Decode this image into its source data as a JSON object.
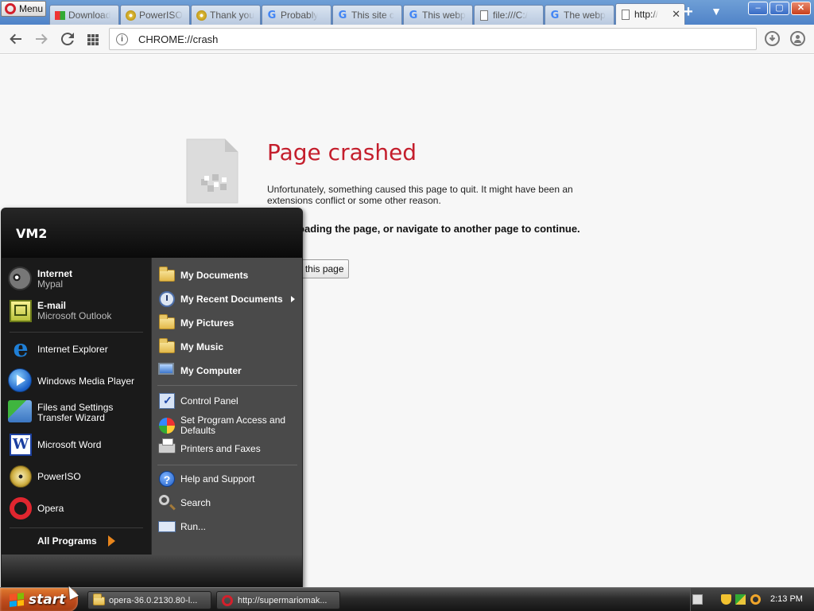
{
  "browser": {
    "menu_label": "Menu",
    "tabs": [
      {
        "title": "Download",
        "icon": "app-icon"
      },
      {
        "title": "PowerISO",
        "icon": "poweriso-icon"
      },
      {
        "title": "Thank you",
        "icon": "poweriso-icon"
      },
      {
        "title": "Probably",
        "icon": "google-icon"
      },
      {
        "title": "This site c",
        "icon": "google-icon"
      },
      {
        "title": "This webp",
        "icon": "google-icon"
      },
      {
        "title": "file:///C:/",
        "icon": "file-icon"
      },
      {
        "title": "The webp",
        "icon": "google-icon"
      },
      {
        "title": "http://",
        "icon": "file-icon",
        "active": true
      }
    ],
    "new_tab_symbol": "+",
    "window_buttons": {
      "minimize": "–",
      "maximize": "▢",
      "close": "✕"
    },
    "url": "CHROME://crash",
    "url_info_symbol": "i"
  },
  "page": {
    "title": "Page crashed",
    "message": "Unfortunately, something caused this page to quit. It might have been an extensions conflict or some other reason.",
    "help": "Try reloading the page, or navigate to another page to continue.",
    "reload_label": "Reload this page"
  },
  "start_menu": {
    "user_name": "VM2",
    "pinned": [
      {
        "title": "Internet",
        "subtitle": "Mypal"
      },
      {
        "title": "E-mail",
        "subtitle": "Microsoft Outlook"
      }
    ],
    "recent": [
      {
        "title": "Internet Explorer"
      },
      {
        "title": "Windows Media Player"
      },
      {
        "title": "Files and Settings Transfer Wizard"
      },
      {
        "title": "Microsoft Word"
      },
      {
        "title": "PowerISO"
      },
      {
        "title": "Opera"
      }
    ],
    "all_programs": "All Programs",
    "places": [
      {
        "title": "My Documents"
      },
      {
        "title": "My Recent Documents"
      },
      {
        "title": "My Pictures"
      },
      {
        "title": "My Music"
      },
      {
        "title": "My Computer"
      }
    ],
    "system": [
      {
        "title": "Control Panel"
      },
      {
        "title": "Set Program Access and Defaults"
      },
      {
        "title": "Printers and Faxes"
      }
    ],
    "support": [
      {
        "title": "Help and Support"
      },
      {
        "title": "Search"
      },
      {
        "title": "Run..."
      }
    ]
  },
  "taskbar": {
    "start_label": "start",
    "tasks": [
      {
        "title": "opera-36.0.2130.80-l..."
      },
      {
        "title": "http://supermariomak..."
      }
    ],
    "clock": "2:13 PM"
  },
  "colors": {
    "crash_red": "#c41e2c",
    "start_green": "#c14d1d",
    "taskbar_dark": "#2b2b2b"
  }
}
